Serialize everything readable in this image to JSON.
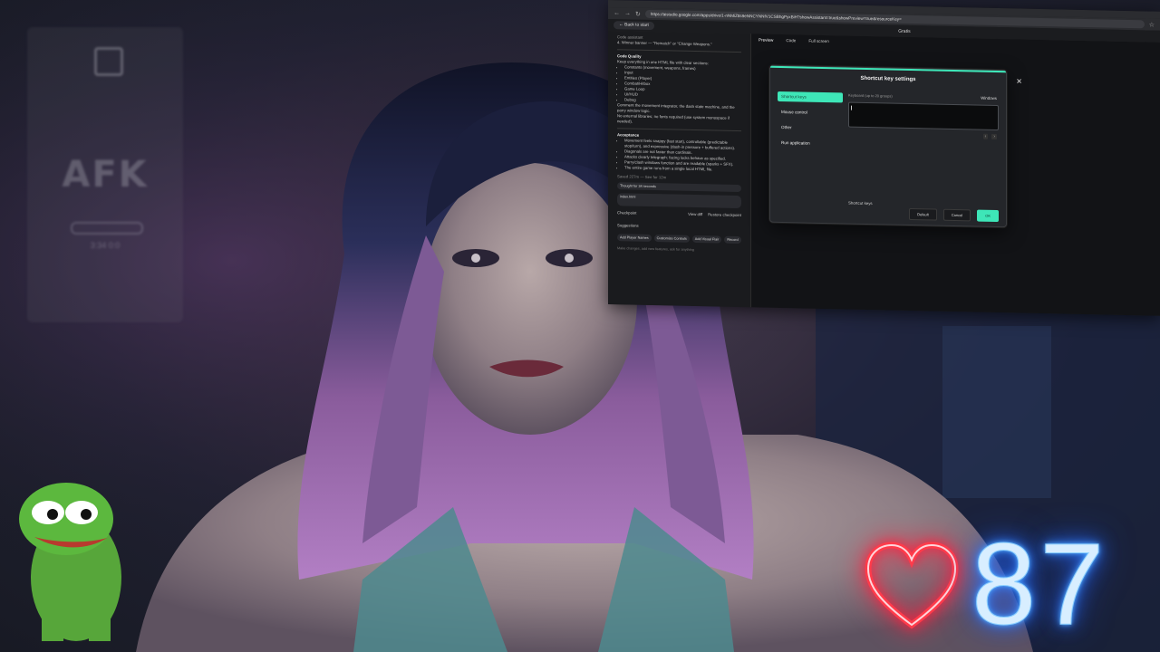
{
  "browser": {
    "url": "https://aistudio.google.com/apps/drive/1-nNMiZ8s9eNNCYNNfV1CSBhgPyxBiH?showAssistant=true&showPreview=true&resourceKey=",
    "back_label": "Back to start",
    "app_title": "Gratis",
    "preview_tab": "Preview",
    "code_tab": "Code",
    "fullscreen_tab": "Full screen"
  },
  "assistant": {
    "code_label": "Code assistant",
    "task_line": "4. Winner banner — \"Rematch\" or \"Change Weapons.\"",
    "section_title": "Code Quality",
    "items": [
      "Keep everything in one HTML file with clear sections:",
      "Constants (movement, weapons, frames)",
      "Input",
      "Entities (Player)",
      "Combat/Hitbox",
      "Game Loop",
      "UI/HUD",
      "Debug",
      "Comment the movement integrator, the dash state machine, and the parry window logic.",
      "No external libraries; no fonts required (use system monospace if needed)."
    ],
    "acceptance_title": "Acceptance",
    "acceptance": [
      "Movement feels snappy (fast start), controllable (predictable stop/turn), and expressive (dash-in pressure + buffered actions).",
      "Diagonals are not faster than cardinals.",
      "Attacks clearly telegraph; facing locks behave as specified.",
      "Parry/clash windows function and are readable (sparks + SFX).",
      "The entire game runs from a single local HTML file."
    ],
    "saved_line": "Saved 227m — See for 12m",
    "thought": "Thought for 34 seconds",
    "file_label": "index.html",
    "checkpoint": "Checkpoint",
    "view_diff": "View diff",
    "restore": "Restore checkpoint",
    "suggestions_title": "Suggestions",
    "chips": [
      "Add Player Names",
      "Customize Controls",
      "Add Visual Flair",
      "Record"
    ],
    "input_placeholder": "Make changes, add new features, ask for anything"
  },
  "dialog": {
    "title": "Shortcut key settings",
    "nav": [
      "Shortcut keys",
      "Mouse control",
      "Other",
      "Run application"
    ],
    "hint": "Keyboard (up to 20 groups)",
    "os": "Windows",
    "shortcut_label": "Shortcut keys",
    "buttons": {
      "default": "Default",
      "cancel": "Cancel",
      "ok": "OK"
    }
  },
  "overlay": {
    "afk_text": "AFK",
    "afk_sub": "3:34 0:0",
    "heart_rate": "87",
    "heart_color": "#ff3b4a",
    "number_color": "#5ab4ff"
  }
}
